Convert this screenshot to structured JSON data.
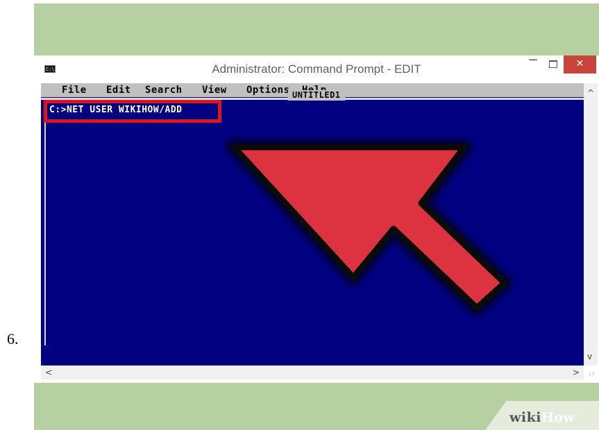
{
  "step": {
    "number": "6."
  },
  "window": {
    "title": "Administrator: Command Prompt - EDIT",
    "icon": "command-prompt-icon",
    "controls": {
      "minimize": "−",
      "close": "✕"
    }
  },
  "editor": {
    "menu": [
      "File",
      "Edit",
      "Search",
      "View",
      "Options",
      "Help"
    ],
    "document_title": "UNTITLED1",
    "command_line": "C:>NET USER WIKIHOW/ADD",
    "background_color": "#000080",
    "highlight_color": "#e0121a",
    "arrow_color": "#dd3340"
  },
  "scrollbars": {
    "up": "^",
    "down": "v",
    "left": "<",
    "right": ">"
  },
  "watermark": {
    "part1": "wiki",
    "part2": "How"
  },
  "colors": {
    "scene_background": "#b7d0a2",
    "close_button": "#c7453a"
  }
}
